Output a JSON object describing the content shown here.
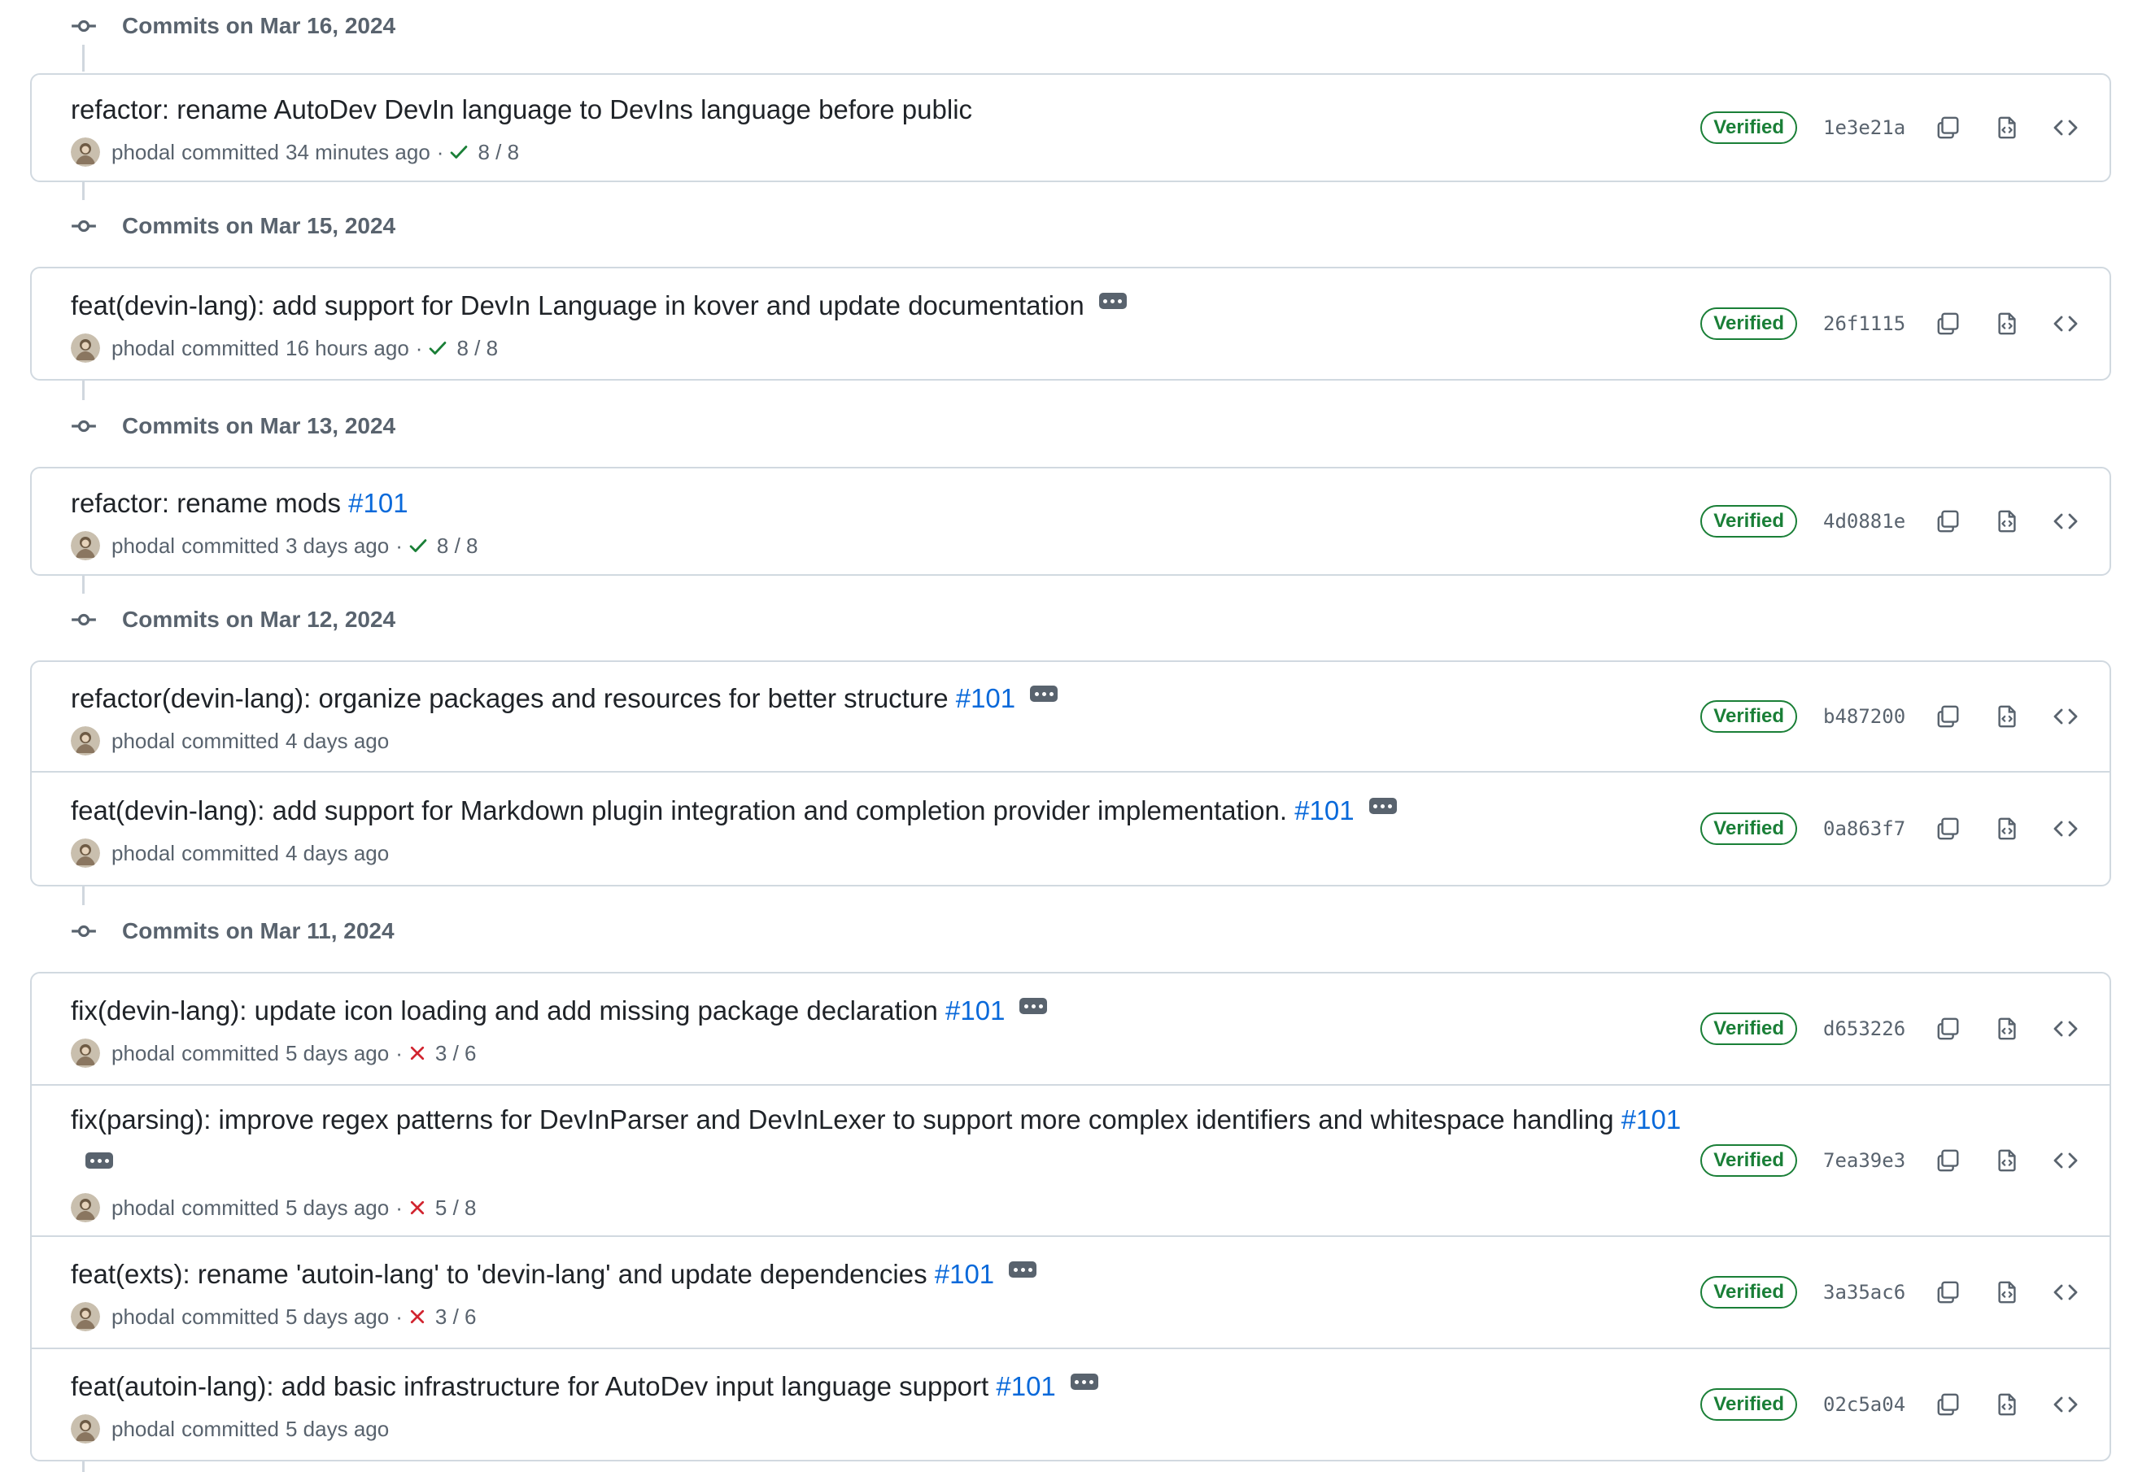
{
  "groups": [
    {
      "date_label": "Commits on Mar 16, 2024",
      "commits": [
        {
          "title": "refactor: rename AutoDev DevIn language to DevIns language before public",
          "ref": "",
          "has_ellipsis": false,
          "author": "phodal",
          "action": "committed",
          "time": "34 minutes ago",
          "status": "success",
          "checks": "8 / 8",
          "verified": "Verified",
          "sha": "1e3e21a"
        }
      ]
    },
    {
      "date_label": "Commits on Mar 15, 2024",
      "commits": [
        {
          "title": "feat(devin-lang): add support for DevIn Language in kover and update documentation",
          "ref": "",
          "has_ellipsis": true,
          "author": "phodal",
          "action": "committed",
          "time": "16 hours ago",
          "status": "success",
          "checks": "8 / 8",
          "verified": "Verified",
          "sha": "26f1115"
        }
      ]
    },
    {
      "date_label": "Commits on Mar 13, 2024",
      "commits": [
        {
          "title": "refactor: rename mods",
          "ref": "#101",
          "has_ellipsis": false,
          "author": "phodal",
          "action": "committed",
          "time": "3 days ago",
          "status": "success",
          "checks": "8 / 8",
          "verified": "Verified",
          "sha": "4d0881e"
        }
      ]
    },
    {
      "date_label": "Commits on Mar 12, 2024",
      "commits": [
        {
          "title": "refactor(devin-lang): organize packages and resources for better structure",
          "ref": "#101",
          "has_ellipsis": true,
          "author": "phodal",
          "action": "committed",
          "time": "4 days ago",
          "status": "",
          "checks": "",
          "verified": "Verified",
          "sha": "b487200"
        },
        {
          "title": "feat(devin-lang): add support for Markdown plugin integration and completion provider implementation.",
          "ref": "#101",
          "has_ellipsis": true,
          "author": "phodal",
          "action": "committed",
          "time": "4 days ago",
          "status": "",
          "checks": "",
          "verified": "Verified",
          "sha": "0a863f7"
        }
      ]
    },
    {
      "date_label": "Commits on Mar 11, 2024",
      "commits": [
        {
          "title": "fix(devin-lang): update icon loading and add missing package declaration",
          "ref": "#101",
          "has_ellipsis": true,
          "author": "phodal",
          "action": "committed",
          "time": "5 days ago",
          "status": "failure",
          "checks": "3 / 6",
          "verified": "Verified",
          "sha": "d653226"
        },
        {
          "title": "fix(parsing): improve regex patterns for DevInParser and DevInLexer to support more complex identifiers and whitespace handling",
          "ref": "#101",
          "has_ellipsis": true,
          "author": "phodal",
          "action": "committed",
          "time": "5 days ago",
          "status": "failure",
          "checks": "5 / 8",
          "verified": "Verified",
          "sha": "7ea39e3"
        },
        {
          "title": "feat(exts): rename 'autoin-lang' to 'devin-lang' and update dependencies",
          "ref": "#101",
          "has_ellipsis": true,
          "author": "phodal",
          "action": "committed",
          "time": "5 days ago",
          "status": "failure",
          "checks": "3 / 6",
          "verified": "Verified",
          "sha": "3a35ac6"
        },
        {
          "title": "feat(autoin-lang): add basic infrastructure for AutoDev input language support",
          "ref": "#101",
          "has_ellipsis": true,
          "author": "phodal",
          "action": "committed",
          "time": "5 days ago",
          "status": "",
          "checks": "",
          "verified": "Verified",
          "sha": "02c5a04"
        }
      ]
    }
  ],
  "icons": {
    "node": "git-commit-icon",
    "copy": "copy-icon",
    "browse": "file-diff-icon",
    "code": "code-icon",
    "success": "check-icon",
    "failure": "x-icon",
    "avatar": "user-avatar"
  },
  "colors": {
    "link": "#0969da",
    "verified": "#1a7f37",
    "success": "#1a7f37",
    "failure": "#d1242f",
    "muted": "#59636e",
    "border": "#d1d9e0"
  }
}
